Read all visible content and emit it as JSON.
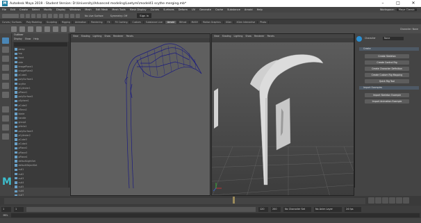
{
  "window": {
    "title": "Autodesk Maya 2019 - Student Version: D:\\University\\Advanced modeling\\Laetymi\\model41 scythe merging.mb*",
    "minimize": "–",
    "maximize": "□",
    "close": "✕"
  },
  "menu": [
    "File",
    "Edit",
    "Create",
    "Select",
    "Modify",
    "Display",
    "Windows",
    "Mesh",
    "Edit Mesh",
    "Mesh Tools",
    "Mesh Display",
    "Curves",
    "Surfaces",
    "Deform",
    "UV",
    "Generate",
    "Cache",
    "Substance",
    "Arnold",
    "Help"
  ],
  "workspace": {
    "label": "Workspace:",
    "value": "Maya Classic"
  },
  "toolbar": {
    "no_live_surface": "No Live Surface",
    "symmetry": "Symmetry: Off",
    "sign_in": "Sign In"
  },
  "shelf_tabs": [
    "Curves / Surfaces",
    "Poly Modeling",
    "Sculpting",
    "Rigging",
    "Animation",
    "Rendering",
    "FX",
    "FX Caching",
    "Custom",
    "Substance Live",
    "Arnold",
    "Bifrost",
    "MASH",
    "Motion Graphics",
    "XGen",
    "XGen Interactive",
    "Photo"
  ],
  "shelf_active": "Arnold",
  "outliner": {
    "title": "Outliner",
    "menu": [
      "Display",
      "Show",
      "Help"
    ],
    "rows": [
      "persp",
      "top",
      "front",
      "side",
      "imagePlane1",
      "imagePlane2",
      "pCube1",
      "polySurface1",
      "scythe",
      "pCylinder1",
      "pPlane1",
      "polySurface2",
      "pSphere1",
      "pCube2",
      "pTorus1",
      "blade",
      "handle",
      "group1",
      "pHelix1",
      "polySurface3",
      "pCylinder2",
      "pCube3",
      "pCube4",
      "pPlane2",
      "pPlane3",
      "pPlane4",
      "defaultLightSet",
      "defaultObjectSet",
      "null1",
      "null2",
      "null3",
      "null4",
      "null5",
      "null6",
      "null7",
      "null8"
    ]
  },
  "viewport_menu": [
    "View",
    "Shading",
    "Lighting",
    "Show",
    "Renderer",
    "Panels"
  ],
  "attr": {
    "top": "Character: None",
    "hik_title": "Character",
    "hik_value": "None",
    "sections": {
      "create": "Create",
      "import": "Import Examples"
    },
    "buttons": [
      "Create Skeleton",
      "Create Control Rig",
      "Create Character Definition",
      "Create Custom Rig Mapping",
      "Quick Rig Tool"
    ],
    "import_buttons": [
      "Import Skeleton Example",
      "Import Animation Example"
    ]
  },
  "time": {
    "start": "1",
    "end": "120",
    "range_start": "1",
    "range_end": "120",
    "range_max": "200",
    "current": "120",
    "fps": "24 fps",
    "no_char": "No Character Set",
    "no_anim": "No Anim Layer"
  },
  "cmd": {
    "lang": "MEL"
  }
}
